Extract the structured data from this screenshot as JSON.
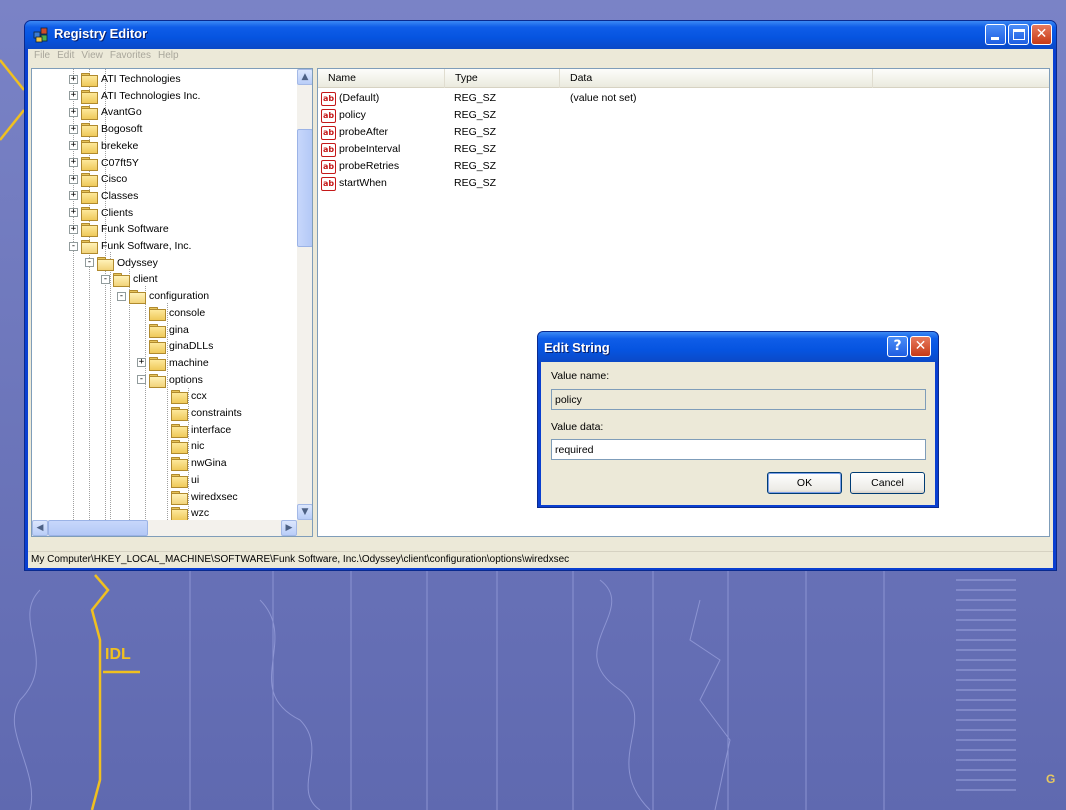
{
  "window": {
    "title": "Registry Editor",
    "menu": [
      "File",
      "Edit",
      "View",
      "Favorites",
      "Help"
    ]
  },
  "tree": {
    "items": [
      {
        "label": "ATI Technologies",
        "depth": 0,
        "expander": "+",
        "open": false
      },
      {
        "label": "ATI Technologies Inc.",
        "depth": 0,
        "expander": "+",
        "open": false
      },
      {
        "label": "AvantGo",
        "depth": 0,
        "expander": "+",
        "open": false
      },
      {
        "label": "Bogosoft",
        "depth": 0,
        "expander": "+",
        "open": false
      },
      {
        "label": "brekeke",
        "depth": 0,
        "expander": "+",
        "open": false
      },
      {
        "label": "C07ft5Y",
        "depth": 0,
        "expander": "+",
        "open": false
      },
      {
        "label": "Cisco",
        "depth": 0,
        "expander": "+",
        "open": false
      },
      {
        "label": "Classes",
        "depth": 0,
        "expander": "+",
        "open": false
      },
      {
        "label": "Clients",
        "depth": 0,
        "expander": "+",
        "open": false
      },
      {
        "label": "Funk Software",
        "depth": 0,
        "expander": "+",
        "open": false
      },
      {
        "label": "Funk Software, Inc.",
        "depth": 0,
        "expander": "-",
        "open": true
      },
      {
        "label": "Odyssey",
        "depth": 1,
        "expander": "-",
        "open": true
      },
      {
        "label": "client",
        "depth": 2,
        "expander": "-",
        "open": true
      },
      {
        "label": "configuration",
        "depth": 3,
        "expander": "-",
        "open": true
      },
      {
        "label": "console",
        "depth": 4,
        "expander": "",
        "open": false
      },
      {
        "label": "gina",
        "depth": 4,
        "expander": "",
        "open": false
      },
      {
        "label": "ginaDLLs",
        "depth": 4,
        "expander": "",
        "open": false
      },
      {
        "label": "machine",
        "depth": 4,
        "expander": "+",
        "open": false
      },
      {
        "label": "options",
        "depth": 4,
        "expander": "-",
        "open": true
      },
      {
        "label": "ccx",
        "depth": 5,
        "expander": "",
        "open": false
      },
      {
        "label": "constraints",
        "depth": 5,
        "expander": "",
        "open": false
      },
      {
        "label": "interface",
        "depth": 5,
        "expander": "",
        "open": false
      },
      {
        "label": "nic",
        "depth": 5,
        "expander": "",
        "open": false
      },
      {
        "label": "nwGina",
        "depth": 5,
        "expander": "",
        "open": false
      },
      {
        "label": "ui",
        "depth": 5,
        "expander": "",
        "open": false
      },
      {
        "label": "wiredxsec",
        "depth": 5,
        "expander": "",
        "open": true
      },
      {
        "label": "wzc",
        "depth": 5,
        "expander": "",
        "open": false
      }
    ],
    "scroll_up": "▲",
    "scroll_down": "▼",
    "scroll_left": "◀",
    "scroll_right": "▶"
  },
  "list": {
    "columns": [
      "Name",
      "Type",
      "Data"
    ],
    "rows": [
      {
        "name": "(Default)",
        "type": "REG_SZ",
        "data": "(value not set)",
        "icon": "ab"
      },
      {
        "name": "policy",
        "type": "REG_SZ",
        "data": "",
        "icon": "ab"
      },
      {
        "name": "probeAfter",
        "type": "REG_SZ",
        "data": "",
        "icon": "ab"
      },
      {
        "name": "probeInterval",
        "type": "REG_SZ",
        "data": "",
        "icon": "ab"
      },
      {
        "name": "probeRetries",
        "type": "REG_SZ",
        "data": "",
        "icon": "ab"
      },
      {
        "name": "startWhen",
        "type": "REG_SZ",
        "data": "",
        "icon": "ab"
      }
    ]
  },
  "statusbar": {
    "path": "My Computer\\HKEY_LOCAL_MACHINE\\SOFTWARE\\Funk Software, Inc.\\Odyssey\\client\\configuration\\options\\wiredxsec"
  },
  "dialog": {
    "title": "Edit String",
    "help_glyph": "?",
    "close_glyph": "✕",
    "value_name_label": "Value name:",
    "value_name": "policy",
    "value_data_label": "Value data:",
    "value_data": "required",
    "ok_label": "OK",
    "cancel_label": "Cancel"
  },
  "desktop": {
    "idl_label": "IDL",
    "gmt_label": "G",
    "colors": {
      "background": "#6f78bd",
      "accent_line": "#f0c020",
      "titlebar": "#0654e0"
    }
  }
}
